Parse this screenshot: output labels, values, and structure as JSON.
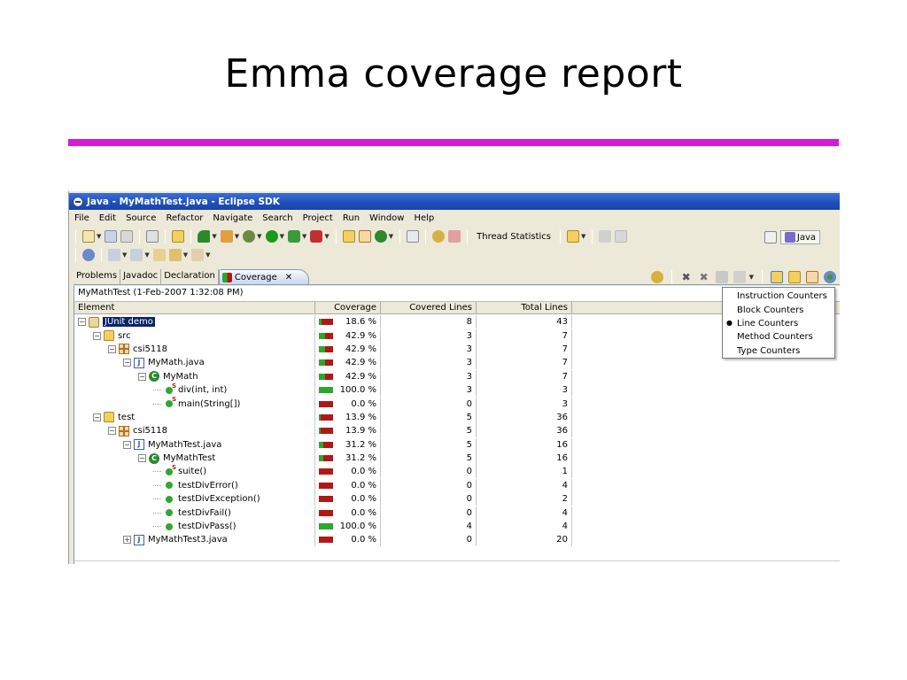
{
  "slide": {
    "title": "Emma coverage report"
  },
  "window": {
    "title": "Java - MyMathTest.java - Eclipse SDK"
  },
  "menu": [
    "File",
    "Edit",
    "Source",
    "Refactor",
    "Navigate",
    "Search",
    "Project",
    "Run",
    "Window",
    "Help"
  ],
  "toolbar": {
    "thread_statistics": "Thread Statistics",
    "perspective": "Java"
  },
  "tabs": [
    {
      "label": "Problems",
      "active": false
    },
    {
      "label": "Javadoc",
      "active": false
    },
    {
      "label": "Declaration",
      "active": false
    },
    {
      "label": "Coverage",
      "active": true
    }
  ],
  "coverage": {
    "session": "MyMathTest (1-Feb-2007 1:32:08 PM)",
    "columns": [
      "Element",
      "Coverage",
      "Covered Lines",
      "Total Lines"
    ],
    "rows": [
      {
        "name": "JUnit demo",
        "icon": "project-icon",
        "depth": 0,
        "expander": "minus",
        "coverage": "18.6 %",
        "covered": "8",
        "total": "43",
        "ratio": 0.186,
        "selected": true
      },
      {
        "name": "src",
        "icon": "folder-icon",
        "depth": 1,
        "expander": "minus",
        "coverage": "42.9 %",
        "covered": "3",
        "total": "7",
        "ratio": 0.429
      },
      {
        "name": "csi5118",
        "icon": "package-icon",
        "depth": 2,
        "expander": "minus",
        "coverage": "42.9 %",
        "covered": "3",
        "total": "7",
        "ratio": 0.429
      },
      {
        "name": "MyMath.java",
        "icon": "java-file-icon",
        "depth": 3,
        "expander": "minus",
        "coverage": "42.9 %",
        "covered": "3",
        "total": "7",
        "ratio": 0.429
      },
      {
        "name": "MyMath",
        "icon": "class-icon",
        "depth": 4,
        "expander": "minus",
        "coverage": "42.9 %",
        "covered": "3",
        "total": "7",
        "ratio": 0.429
      },
      {
        "name": "div(int, int)",
        "icon": "static-method-icon",
        "depth": 5,
        "expander": "leaf",
        "coverage": "100.0 %",
        "covered": "3",
        "total": "3",
        "ratio": 1.0
      },
      {
        "name": "main(String[])",
        "icon": "static-method-icon",
        "depth": 5,
        "expander": "leaf",
        "coverage": "0.0 %",
        "covered": "0",
        "total": "3",
        "ratio": 0.0
      },
      {
        "name": "test",
        "icon": "folder-icon",
        "depth": 1,
        "expander": "minus",
        "coverage": "13.9 %",
        "covered": "5",
        "total": "36",
        "ratio": 0.139
      },
      {
        "name": "csi5118",
        "icon": "package-icon",
        "depth": 2,
        "expander": "minus",
        "coverage": "13.9 %",
        "covered": "5",
        "total": "36",
        "ratio": 0.139
      },
      {
        "name": "MyMathTest.java",
        "icon": "java-file-icon",
        "depth": 3,
        "expander": "minus",
        "coverage": "31.2 %",
        "covered": "5",
        "total": "16",
        "ratio": 0.312
      },
      {
        "name": "MyMathTest",
        "icon": "class-icon",
        "depth": 4,
        "expander": "minus",
        "coverage": "31.2 %",
        "covered": "5",
        "total": "16",
        "ratio": 0.312
      },
      {
        "name": "suite()",
        "icon": "static-method-icon",
        "depth": 5,
        "expander": "leaf",
        "coverage": "0.0 %",
        "covered": "0",
        "total": "1",
        "ratio": 0.0
      },
      {
        "name": "testDivError()",
        "icon": "method-icon",
        "depth": 5,
        "expander": "leaf",
        "coverage": "0.0 %",
        "covered": "0",
        "total": "4",
        "ratio": 0.0
      },
      {
        "name": "testDivException()",
        "icon": "method-icon",
        "depth": 5,
        "expander": "leaf",
        "coverage": "0.0 %",
        "covered": "0",
        "total": "2",
        "ratio": 0.0
      },
      {
        "name": "testDivFail()",
        "icon": "method-icon",
        "depth": 5,
        "expander": "leaf",
        "coverage": "0.0 %",
        "covered": "0",
        "total": "4",
        "ratio": 0.0
      },
      {
        "name": "testDivPass()",
        "icon": "method-icon",
        "depth": 5,
        "expander": "leaf",
        "coverage": "100.0 %",
        "covered": "4",
        "total": "4",
        "ratio": 1.0
      },
      {
        "name": "MyMathTest3.java",
        "icon": "java-file-icon",
        "depth": 3,
        "expander": "plus",
        "coverage": "0.0 %",
        "covered": "0",
        "total": "20",
        "ratio": 0.0
      }
    ]
  },
  "counter_menu": [
    {
      "label": "Instruction Counters",
      "checked": false
    },
    {
      "label": "Block Counters",
      "checked": false
    },
    {
      "label": "Line Counters",
      "checked": true
    },
    {
      "label": "Method Counters",
      "checked": false
    },
    {
      "label": "Type Counters",
      "checked": false
    }
  ],
  "colors": {
    "covered": "#2aa82a",
    "missed": "#b01818",
    "accent_rule": "#d61ad6",
    "titlebar": "#1f4fb8"
  }
}
